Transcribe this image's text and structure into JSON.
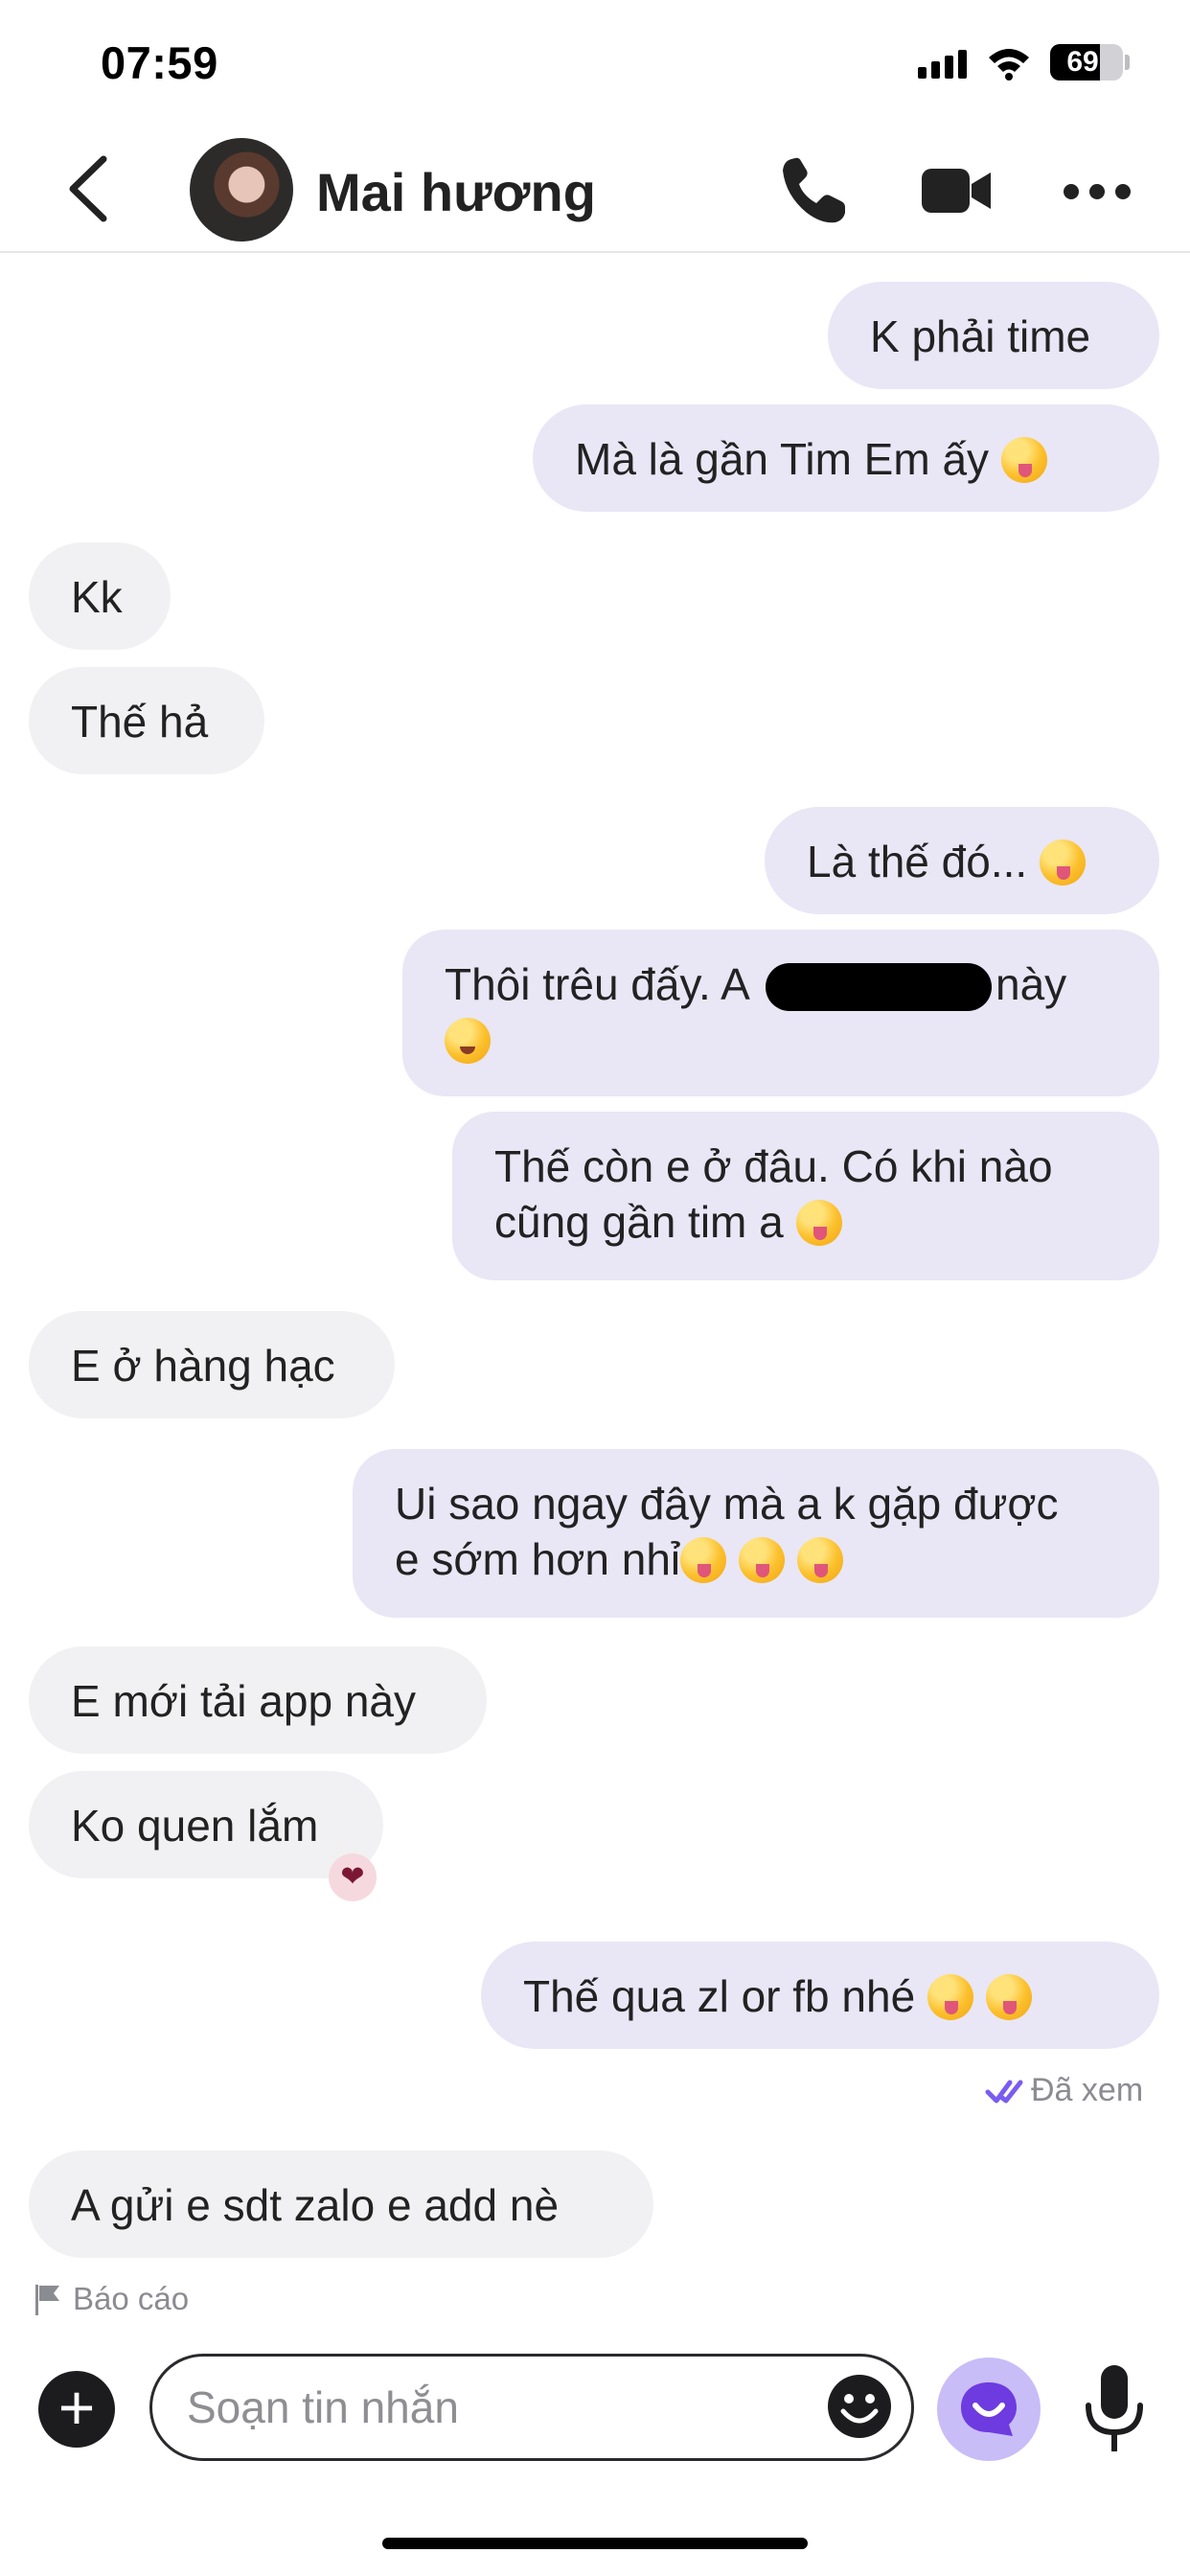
{
  "status_bar": {
    "time": "07:59",
    "battery": "69",
    "battery_level": 0.69
  },
  "header": {
    "contact_name": "Mai hương"
  },
  "messages": [
    {
      "dir": "out",
      "text": "K phải time"
    },
    {
      "dir": "out",
      "text": "Mà là gần  Tim Em ấy",
      "emoji": [
        "squinting-tongue"
      ]
    },
    {
      "dir": "in",
      "text": "Kk"
    },
    {
      "dir": "in",
      "text": "Thế hả"
    },
    {
      "dir": "out",
      "text": "Là thế đó...",
      "emoji": [
        "laughing"
      ]
    },
    {
      "dir": "out",
      "text_a": "Thôi trêu đấy. A",
      "text_b": "này",
      "redacted": true,
      "emoji": [
        "smiling-hearts"
      ]
    },
    {
      "dir": "out",
      "line1": "Thế còn e ở đâu. Có khi nào",
      "line2": "cũng gần tim a",
      "emoji": [
        "laughing"
      ]
    },
    {
      "dir": "in",
      "text": "E ở hàng hạc"
    },
    {
      "dir": "out",
      "line1": "Ui sao ngay đây mà a k gặp được",
      "line2": "e sớm hơn nhỉ",
      "emoji": [
        "squinting-tongue",
        "squinting-tongue",
        "squinting-tongue"
      ]
    },
    {
      "dir": "in",
      "text": "E mới tải app này"
    },
    {
      "dir": "in",
      "text": "Ko quen lắm",
      "reaction": "heart"
    },
    {
      "dir": "out",
      "text": "Thế qua zl or fb  nhé",
      "emoji": [
        "squinting-tongue",
        "squinting-tongue"
      ]
    },
    {
      "dir": "in",
      "text": "A gửi e sdt zalo e add nè"
    }
  ],
  "seen_label": "Đã xem",
  "report_label": "Báo cáo",
  "composer": {
    "placeholder": "Soạn tin nhắn"
  },
  "colors": {
    "outgoing_bubble": "#e9e6f6",
    "incoming_bubble": "#f1f1f3",
    "accent": "#7b5cf0"
  },
  "icons": [
    "back-icon",
    "phone-icon",
    "video-icon",
    "more-icon",
    "checkmark-icon",
    "flag-icon",
    "plus-icon",
    "emoji-icon",
    "ai-assistant-icon",
    "microphone-icon"
  ]
}
